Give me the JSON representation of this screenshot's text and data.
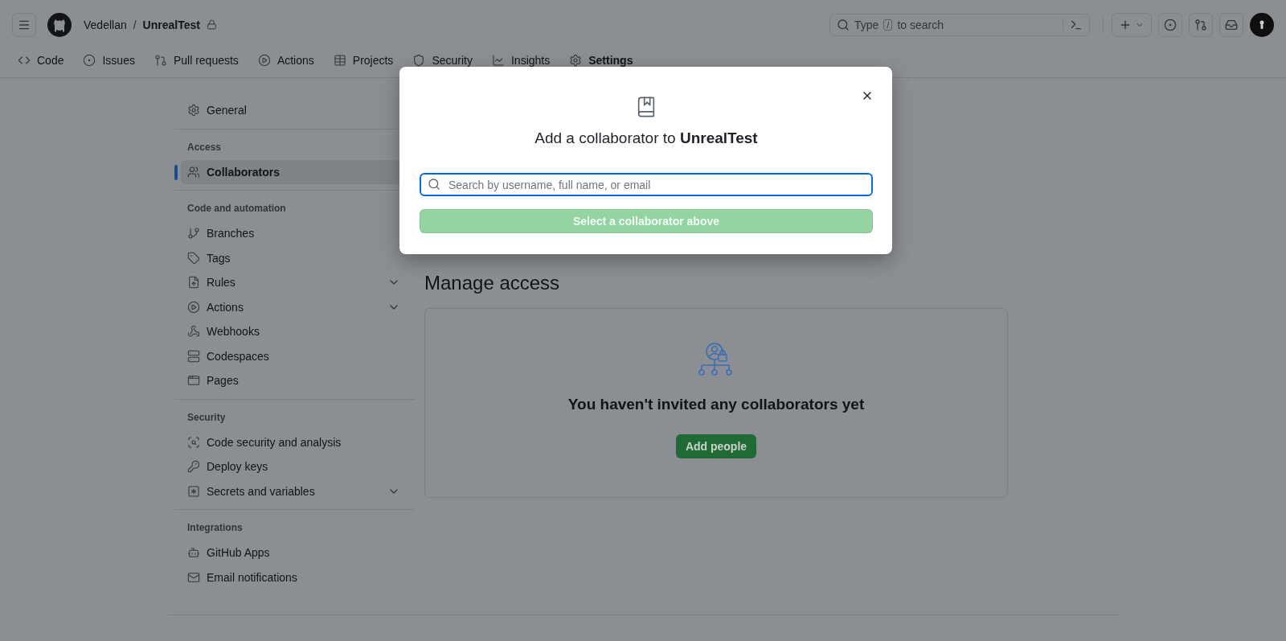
{
  "header": {
    "owner": "Vedellan",
    "separator": "/",
    "repo": "UnrealTest",
    "search": {
      "before": "Type",
      "key": "/",
      "after": "to search"
    }
  },
  "repo_tabs": [
    {
      "label": "Code",
      "selected": false
    },
    {
      "label": "Issues",
      "selected": false
    },
    {
      "label": "Pull requests",
      "selected": false
    },
    {
      "label": "Actions",
      "selected": false
    },
    {
      "label": "Projects",
      "selected": false
    },
    {
      "label": "Security",
      "selected": false
    },
    {
      "label": "Insights",
      "selected": false
    },
    {
      "label": "Settings",
      "selected": true
    }
  ],
  "sidebar": {
    "sections": [
      {
        "items": [
          {
            "label": "General",
            "selected": false,
            "expandable": false
          }
        ]
      },
      {
        "heading": "Access",
        "items": [
          {
            "label": "Collaborators",
            "selected": true,
            "expandable": false
          }
        ]
      },
      {
        "heading": "Code and automation",
        "items": [
          {
            "label": "Branches",
            "selected": false,
            "expandable": false
          },
          {
            "label": "Tags",
            "selected": false,
            "expandable": false
          },
          {
            "label": "Rules",
            "selected": false,
            "expandable": true
          },
          {
            "label": "Actions",
            "selected": false,
            "expandable": true
          },
          {
            "label": "Webhooks",
            "selected": false,
            "expandable": false
          },
          {
            "label": "Codespaces",
            "selected": false,
            "expandable": false
          },
          {
            "label": "Pages",
            "selected": false,
            "expandable": false
          }
        ]
      },
      {
        "heading": "Security",
        "items": [
          {
            "label": "Code security and analysis",
            "selected": false,
            "expandable": false
          },
          {
            "label": "Deploy keys",
            "selected": false,
            "expandable": false
          },
          {
            "label": "Secrets and variables",
            "selected": false,
            "expandable": true
          }
        ]
      },
      {
        "heading": "Integrations",
        "items": [
          {
            "label": "GitHub Apps",
            "selected": false,
            "expandable": false
          },
          {
            "label": "Email notifications",
            "selected": false,
            "expandable": false
          }
        ]
      }
    ]
  },
  "manage_access": {
    "title": "Manage access",
    "message": "You haven't invited any collaborators yet",
    "button": "Add people"
  },
  "dialog": {
    "title": "Add a collaborator to **UnrealTest**",
    "search": {
      "placeholder": "Search by username, full name, or email"
    },
    "submit": {
      "label": "Select a collaborator above",
      "disabled": true
    }
  }
}
